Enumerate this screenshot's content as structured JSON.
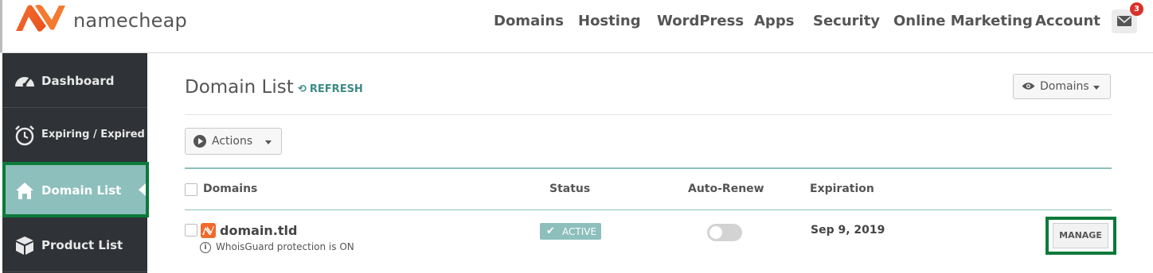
{
  "header": {
    "brand": "namecheap",
    "nav": [
      "Domains",
      "Hosting",
      "WordPress",
      "Apps",
      "Security",
      "Online Marketing",
      "Account"
    ],
    "mail_icon": "envelope-icon",
    "notification_count": "3"
  },
  "sidebar": {
    "items": [
      {
        "label": "Dashboard",
        "icon": "dashboard-gauge-icon"
      },
      {
        "label": "Expiring / Expired",
        "icon": "clock-timer-icon"
      },
      {
        "label": "Domain List",
        "icon": "home-icon",
        "active": true
      },
      {
        "label": "Product List",
        "icon": "box-icon"
      }
    ]
  },
  "main": {
    "title": "Domain List",
    "refresh_label": "REFRESH",
    "view_select": "Domains",
    "actions_label": "Actions",
    "columns": [
      "Domains",
      "Status",
      "Auto-Renew",
      "Expiration"
    ],
    "rows": [
      {
        "domain": "domain.tld",
        "whoisguard": "WhoisGuard protection is ON",
        "status": "ACTIVE",
        "auto_renew": false,
        "expiration": "Sep 9, 2019",
        "manage_label": "MANAGE"
      }
    ]
  },
  "colors": {
    "brand_orange": "#ef6a2c",
    "sidebar_bg": "#2f3236",
    "teal_accent": "#8dbfbc",
    "highlight_green": "#0b7a3a"
  }
}
